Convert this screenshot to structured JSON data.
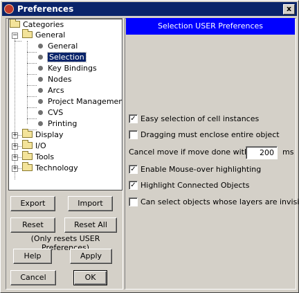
{
  "window": {
    "title": "Preferences",
    "close_glyph": "x"
  },
  "tree": {
    "root": "Categories",
    "general": "General",
    "general_children": [
      "General",
      "Selection",
      "Key Bindings",
      "Nodes",
      "Arcs",
      "Project Management",
      "CVS",
      "Printing"
    ],
    "selected": "Selection",
    "other_groups": [
      "Display",
      "I/O",
      "Tools",
      "Technology"
    ],
    "expanded_marker": "−",
    "collapsed_marker": "+"
  },
  "left_buttons": {
    "export": "Export",
    "import": "Import",
    "reset": "Reset",
    "reset_all": "Reset All",
    "reset_note": "(Only resets USER Preferences)",
    "help": "Help",
    "apply": "Apply",
    "cancel": "Cancel",
    "ok": "OK"
  },
  "panel": {
    "header": "Selection USER Preferences",
    "easy_selection": {
      "label": "Easy selection of cell instances",
      "checked": true
    },
    "drag_enclose": {
      "label": "Dragging must enclose entire object",
      "checked": false
    },
    "cancel_move": {
      "label": "Cancel move if move done within:",
      "value": "200",
      "unit": "ms"
    },
    "mouse_over": {
      "label": "Enable Mouse-over highlighting",
      "checked": true
    },
    "highlight_connected": {
      "label": "Highlight Connected Objects",
      "checked": true
    },
    "invisible_layers": {
      "label": "Can select objects whose layers are invisible",
      "checked": false
    },
    "check_glyph": "✓"
  },
  "colors": {
    "title_bar": "#0a246a",
    "panel_header": "#0000ff",
    "face": "#d4d0c8",
    "selection": "#0a246a"
  }
}
